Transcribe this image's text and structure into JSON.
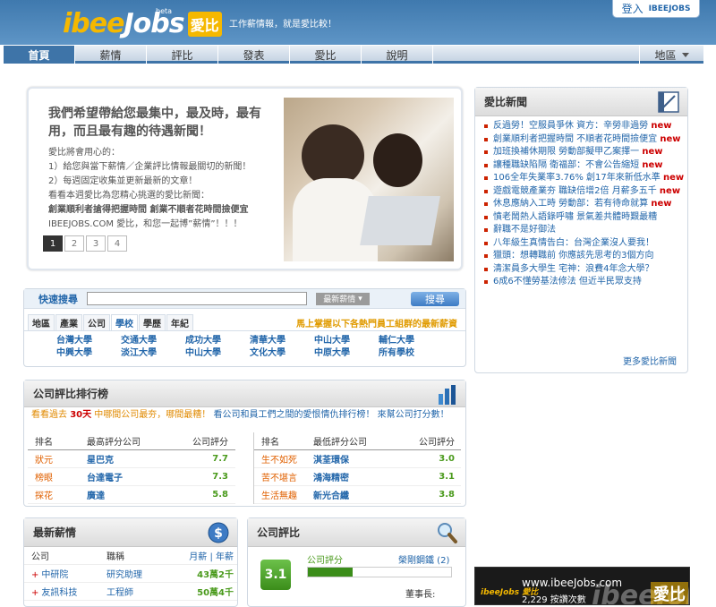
{
  "header": {
    "logo_ibee": "ibee",
    "logo_jobs": "Jobs",
    "logo_beta": "beta",
    "logo_aibi": "愛比",
    "slogan": "工作薪情報，就是愛比較！",
    "login_label": "登入",
    "login_brand": "IBEEJOBS"
  },
  "nav": {
    "tabs": [
      "首頁",
      "薪情",
      "評比",
      "發表",
      "愛比",
      "說明"
    ],
    "region_label": "地區"
  },
  "promo": {
    "headline": "我們希望帶給您最集中，最及時，最有用，而且最有趣的待遇新聞！",
    "intro_title": "愛比將會用心的：",
    "point1": "1）給您與當下薪情／企業評比情報最關切的新聞！",
    "point2": "2）每週固定收集並更新最新的文章！",
    "point3": "看看本週愛比為您精心挑選的愛比新聞：",
    "featured": "創業順利者搶得把握時間 創業不順者花時間撿便宜",
    "closing": "IBEEJOBS.COM 愛比，和您一起博”薪情”！！！",
    "pages": [
      "1",
      "2",
      "3",
      "4"
    ]
  },
  "news": {
    "title": "愛比新聞",
    "items": [
      {
        "text": "反過勞！空服員爭休 資方：辛勞非過勞",
        "new": "new"
      },
      {
        "text": "創業順利者把握時間 不順者花時間撿便宜",
        "new": "new"
      },
      {
        "text": "加班換補休期限 勞動部擬甲乙案擇一",
        "new": "new"
      },
      {
        "text": "讓種職缺陷隔 衛福部：不會公告縮短",
        "new": "new"
      },
      {
        "text": "106全年失業率3.76% 創17年來新低水準",
        "new": "new"
      },
      {
        "text": "遊戲電競產業夯 職缺倍增2倍 月薪多五千",
        "new": "new"
      },
      {
        "text": "休息應納入工時 勞動部：若有待命就算",
        "new": "new"
      },
      {
        "text": "憤老鬧熱人語錄呼嘯 景氣差共體時艱最糟",
        "new": ""
      },
      {
        "text": "辭職不是好御法",
        "new": ""
      },
      {
        "text": "八年級生真情告白：台灣企業沒人要我！",
        "new": ""
      },
      {
        "text": "獵頭：想轉職前 你應該先思考的3個方向",
        "new": ""
      },
      {
        "text": "清潔員多大學生 宅神：浪費4年念大學？",
        "new": ""
      },
      {
        "text": "6成6不懂勞基法修法 但近半民眾支持",
        "new": ""
      }
    ],
    "more": "更多愛比新聞"
  },
  "search": {
    "label": "快速搜尋",
    "value": "",
    "select_value": "最新薪情",
    "button": "搜尋",
    "tabs": [
      "地區",
      "產業",
      "公司",
      "學校",
      "學歷",
      "年紀"
    ],
    "active_tab": "學校",
    "note": "馬上掌握以下各熱門員工組群的最新薪資",
    "schools": [
      "台灣大學",
      "交通大學",
      "成功大學",
      "清華大學",
      "中山大學",
      "輔仁大學",
      "中興大學",
      "淡江大學",
      "中山大學",
      "文化大學",
      "中原大學",
      "所有學校"
    ]
  },
  "rank": {
    "title": "公司評比排行榜",
    "intro_a": "看看過去",
    "intro_days": "30天",
    "intro_b": "中哪間公司最夯，哪間最糟！",
    "intro_c": "看公司和員工們之間的愛恨情仇排行榜！",
    "intro_d": "來幫公司打分數！",
    "left": {
      "headers": [
        "排名",
        "最高評分公司",
        "公司評分"
      ],
      "rows": [
        {
          "rank": "狀元",
          "company": "星巴克",
          "score": "7.7"
        },
        {
          "rank": "榜眼",
          "company": "台達電子",
          "score": "7.3"
        },
        {
          "rank": "探花",
          "company": "廣達",
          "score": "5.8"
        }
      ]
    },
    "right": {
      "headers": [
        "排名",
        "最低評分公司",
        "公司評分"
      ],
      "rows": [
        {
          "rank": "生不如死",
          "company": "淇荃環保",
          "score": "3.0"
        },
        {
          "rank": "苦不堪言",
          "company": "鴻海精密",
          "score": "3.1"
        },
        {
          "rank": "生活無趣",
          "company": "新光合纖",
          "score": "3.8"
        }
      ]
    }
  },
  "salary": {
    "title": "最新薪情",
    "headers": [
      "公司",
      "職稱"
    ],
    "header_link1": "月薪",
    "header_sep": "|",
    "header_link2": "年薪",
    "rows": [
      {
        "company": "中研院",
        "job": "研究助理",
        "amount": "43萬2千"
      },
      {
        "company": "友訊科技",
        "job": "工程師",
        "amount": "50萬4千"
      }
    ]
  },
  "compare": {
    "title": "公司評比",
    "score": "3.1",
    "score_label": "公司評分",
    "score_fraction": 0.31,
    "company": "榮剛鋼鐵 (2)",
    "role": "董事長:"
  },
  "banner": {
    "url": "www.ibeeJobs.com",
    "count": "2,229 按讚次數",
    "mini_logo": "ibeeJobs 愛比",
    "big_logo": "ibeeJobs",
    "big_aibi": "愛比"
  },
  "colors": {
    "header_blue": "#3f79ae",
    "accent_gold": "#f5b800",
    "new_red": "#cc0000",
    "link_blue": "#2266aa",
    "score_green": "#3b8d1a"
  }
}
